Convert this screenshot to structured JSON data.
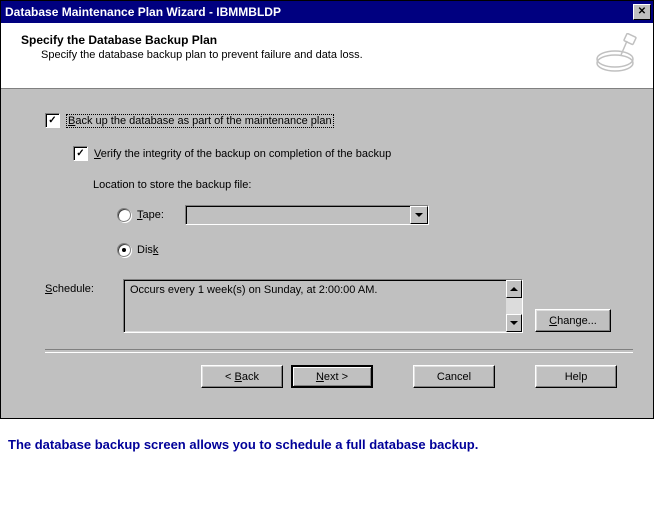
{
  "window": {
    "title": "Database Maintenance Plan Wizard - IBMMBLDP"
  },
  "header": {
    "title": "Specify the Database Backup Plan",
    "subtitle": "Specify the database backup plan to prevent failure and data loss."
  },
  "form": {
    "backup_cb_prefix": "B",
    "backup_cb_rest": "ack up the database as part of the maintenance plan",
    "verify_cb_prefix": "V",
    "verify_cb_rest": "erify the integrity of the backup on completion of the backup",
    "location_label": "Location to store the backup file:",
    "tape_prefix": "T",
    "tape_rest": "ape:",
    "tape_value": "",
    "disk_prefix": "D",
    "disk_rest": "is",
    "disk_suffix": "k",
    "schedule_prefix": "S",
    "schedule_rest": "chedule:",
    "schedule_text": "Occurs every 1 week(s) on Sunday, at 2:00:00 AM.",
    "change_prefix": "C",
    "change_rest": "hange..."
  },
  "buttons": {
    "back_prefix": "B",
    "back_rest": "ack",
    "next_prefix": "N",
    "next_rest": "ext >",
    "cancel": "Cancel",
    "help": "Help"
  },
  "caption": "The database backup screen allows you to schedule a full database backup."
}
